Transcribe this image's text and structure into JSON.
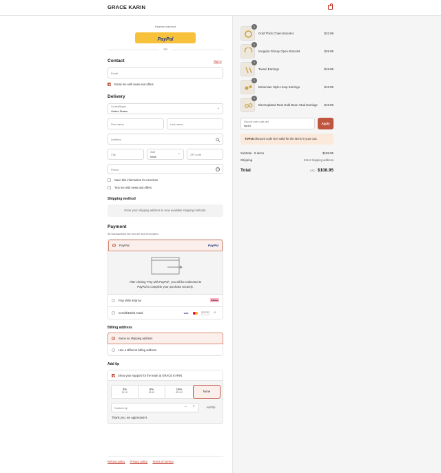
{
  "header": {
    "brand": "GRACE KARIN"
  },
  "express": {
    "title": "Express checkout",
    "paypal_label": "PayPal",
    "or": "OR"
  },
  "contact": {
    "title": "Contact",
    "signin": "Sign in",
    "email_placeholder": "Email",
    "news_label": "Email me with news and offers"
  },
  "delivery": {
    "title": "Delivery",
    "country_label": "Country/Region",
    "country_value": "United States",
    "first_name": "First name",
    "last_name": "Last name",
    "address": "Address",
    "city": "City",
    "state_label": "State",
    "state_value": "Iowa",
    "zip": "ZIP code",
    "phone": "Phone",
    "save_info": "Save this information for next time",
    "text_me": "Text me with news and offers"
  },
  "shipping": {
    "title": "Shipping method",
    "message": "Enter your shipping address to view available shipping methods."
  },
  "payment": {
    "title": "Payment",
    "subtitle": "All transactions are secure and encrypted.",
    "paypal": "PayPal",
    "paypal_logo": "PayPal",
    "redirect_text": "After clicking \"Pay with PayPal\", you will be redirected to PayPal to complete your purchase securely.",
    "klarna": "Pay With Klarna",
    "klarna_badge": "Klarna.",
    "card": "Credit/Debit Card",
    "card_brands": [
      "VISA",
      "MC",
      "DISCOVER",
      "+1"
    ]
  },
  "billing": {
    "title": "Billing address",
    "same": "Same as shipping address",
    "different": "Use a different billing address"
  },
  "tip": {
    "title": "Add tip",
    "support": "Show your support for the team at GRACE KARIN",
    "options": [
      {
        "pct": "2%",
        "amt": "$2.18"
      },
      {
        "pct": "5%",
        "amt": "$5.45"
      },
      {
        "pct": "10%",
        "amt": "$10.90"
      },
      {
        "pct": "None",
        "amt": ""
      }
    ],
    "custom_placeholder": "Custom tip",
    "add_button": "Add tip",
    "thanks": "Thank you, we appreciate it."
  },
  "footer": {
    "links": [
      "Refund policy",
      "Privacy policy",
      "Terms of service"
    ]
  },
  "cart": {
    "items": [
      {
        "name": "Gold Thick Chain Bracelet",
        "price": "$22.99",
        "qty": "1"
      },
      {
        "name": "Irregular Glossy Open Bracelet",
        "price": "$29.99",
        "qty": "1"
      },
      {
        "name": "Tassel Earrings",
        "price": "$18.99",
        "qty": "1"
      },
      {
        "name": "Bohemian Style Hoop Earrings",
        "price": "$16.99",
        "qty": "1"
      },
      {
        "name": "Electroplated Real Gold Bean Stud Earrings",
        "price": "$19.99",
        "qty": "1"
      }
    ],
    "discount_label": "Discount code or gift card",
    "discount_value": "top15",
    "apply": "Apply",
    "error_code": "TOP15",
    "error_text": " discount code isn't valid for the items in your cart.",
    "subtotal_label": "Subtotal · 5 items",
    "subtotal_value": "$108.95",
    "shipping_label": "Shipping",
    "shipping_value": "Enter shipping address",
    "total_label": "Total",
    "currency": "USD",
    "total_value": "$108.95"
  },
  "colors": {
    "accent": "#c0553f",
    "paypal_yellow": "#f7c13c",
    "paypal_blue": "#253b80"
  }
}
